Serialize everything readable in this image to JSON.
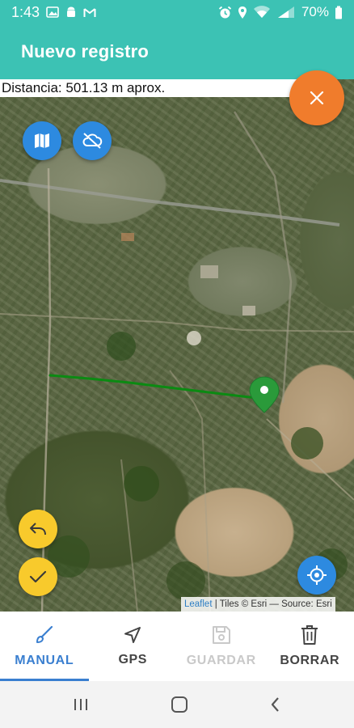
{
  "status_bar": {
    "time": "1:43",
    "battery": "70%",
    "left_icons": [
      "image-icon",
      "android-icon",
      "gmail-icon"
    ],
    "right_icons": [
      "alarm-icon",
      "location-icon",
      "wifi-icon",
      "signal-icon",
      "battery-icon"
    ]
  },
  "app_bar": {
    "title": "Nuevo registro"
  },
  "map": {
    "distance": "Distancia: 501.13 m aprox.",
    "attribution_link": "Leaflet",
    "attribution_text": " | Tiles © Esri — Source: Esri",
    "track_color": "#0b8a12",
    "marker_color": "#2a9a3a"
  },
  "buttons": {
    "close": "close-icon",
    "layers": "map-icon",
    "offline": "cloud-off-icon",
    "undo": "undo-icon",
    "confirm": "check-icon",
    "locate": "crosshair-icon"
  },
  "tabs": [
    {
      "label": "MANUAL",
      "icon": "brush-icon",
      "state": "active"
    },
    {
      "label": "GPS",
      "icon": "navigation-icon",
      "state": "normal"
    },
    {
      "label": "GUARDAR",
      "icon": "save-icon",
      "state": "disabled"
    },
    {
      "label": "BORRAR",
      "icon": "trash-icon",
      "state": "normal"
    }
  ],
  "nav": [
    "recents-icon",
    "home-icon",
    "back-icon"
  ],
  "colors": {
    "primary": "#3cc2b4",
    "accent_orange": "#f07c2c",
    "fab_blue": "#2d8ae0",
    "fab_yellow": "#f8ca2c",
    "tab_active": "#3a7fd0"
  }
}
